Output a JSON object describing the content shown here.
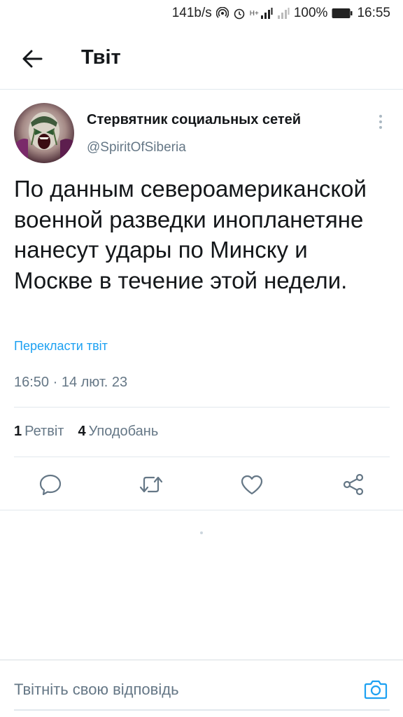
{
  "status_bar": {
    "network_speed": "141b/s",
    "network_type": "H+",
    "battery_percent": "100%",
    "time": "16:55",
    "icons": [
      "hotspot-icon",
      "alarm-icon",
      "signal-icon",
      "signal-icon-2",
      "battery-icon"
    ]
  },
  "header": {
    "back_icon": "arrow-left-icon",
    "title": "Твіт"
  },
  "tweet": {
    "author_name": "Стервятник социальных сетей",
    "author_handle": "@SpiritOfSiberia",
    "text": "По данным североамериканской военной разведки инопланетяне нанесут удары по Минску и Москве в течение этой недели.",
    "translate_label": "Перекласти твіт",
    "timestamp": "16:50 · 14 лют. 23",
    "more_icon": "more-vertical-icon"
  },
  "stats": {
    "retweets_count": "1",
    "retweets_label": "Ретвіт",
    "likes_count": "4",
    "likes_label": "Уподобань"
  },
  "actions": [
    "reply-icon",
    "retweet-icon",
    "like-icon",
    "share-icon"
  ],
  "reply": {
    "placeholder": "Твітніть свою відповідь",
    "camera_icon": "camera-icon"
  },
  "colors": {
    "accent": "#1da1f2",
    "secondary_text": "#657786",
    "action_icon": "#657786",
    "divider": "#e1e8ed"
  }
}
